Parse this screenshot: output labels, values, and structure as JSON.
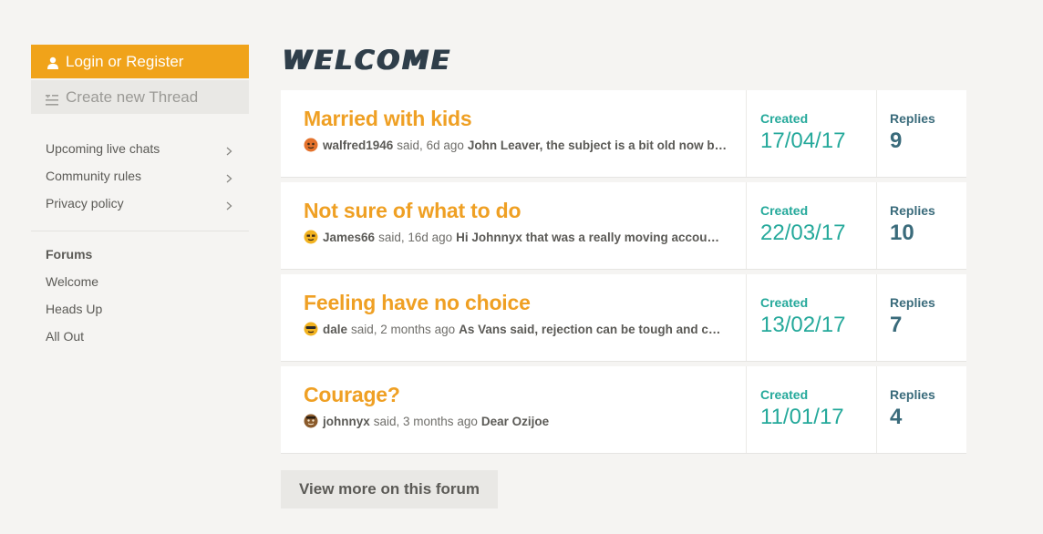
{
  "sidebar": {
    "login_label": "Login or Register",
    "new_thread_label": "Create new Thread",
    "links": [
      {
        "label": "Upcoming live chats"
      },
      {
        "label": "Community rules"
      },
      {
        "label": "Privacy policy"
      }
    ],
    "forums_heading": "Forums",
    "forums": [
      {
        "label": "Welcome"
      },
      {
        "label": "Heads Up"
      },
      {
        "label": "All Out"
      }
    ]
  },
  "main": {
    "title": "Welcome",
    "created_label": "Created",
    "replies_label": "Replies",
    "threads": [
      {
        "title": "Married with kids",
        "user": "walfred1946",
        "said": "said, 6d ago",
        "excerpt": "John Leaver, the subject is a bit old now but…",
        "created": "17/04/17",
        "replies": "9",
        "avatar_color": "#e4722c"
      },
      {
        "title": "Not sure of what to do",
        "user": "James66",
        "said": "said, 16d ago",
        "excerpt": "Hi Johnnyx that was a really moving account o…",
        "created": "22/03/17",
        "replies": "10",
        "avatar_color": "#f2b320"
      },
      {
        "title": "Feeling have no choice",
        "user": "dale",
        "said": "said, 2 months ago",
        "excerpt": "As Vans said, rejection can be tough and can…",
        "created": "13/02/17",
        "replies": "7",
        "avatar_color": "#f2b320"
      },
      {
        "title": "Courage?",
        "user": "johnnyx",
        "said": "said, 3 months ago",
        "excerpt": "Dear Ozijoe",
        "created": "11/01/17",
        "replies": "4",
        "avatar_color": "#8a5a2b"
      }
    ],
    "view_more_label": "View more on this forum"
  },
  "colors": {
    "accent": "#f0a31a",
    "created": "#25a99b",
    "replies": "#3a6b7b",
    "title": "#2f3e4a"
  }
}
